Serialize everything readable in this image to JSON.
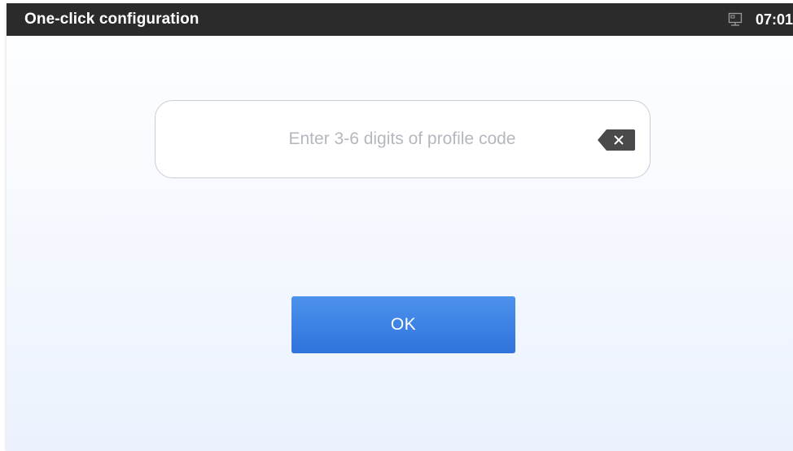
{
  "status_bar": {
    "title": "One-click configuration",
    "network_icon": "ethernet-icon",
    "time": "07:01"
  },
  "profile_code": {
    "value": "",
    "placeholder": "Enter 3-6 digits of profile code",
    "clear_icon": "backspace-icon"
  },
  "actions": {
    "ok_label": "OK"
  },
  "colors": {
    "status_bar_bg": "#2b2b2b",
    "button_top": "#4d92ec",
    "button_bottom": "#2f73dc",
    "placeholder_text": "#b4b8be",
    "backspace_icon": "#4a4a4a"
  }
}
